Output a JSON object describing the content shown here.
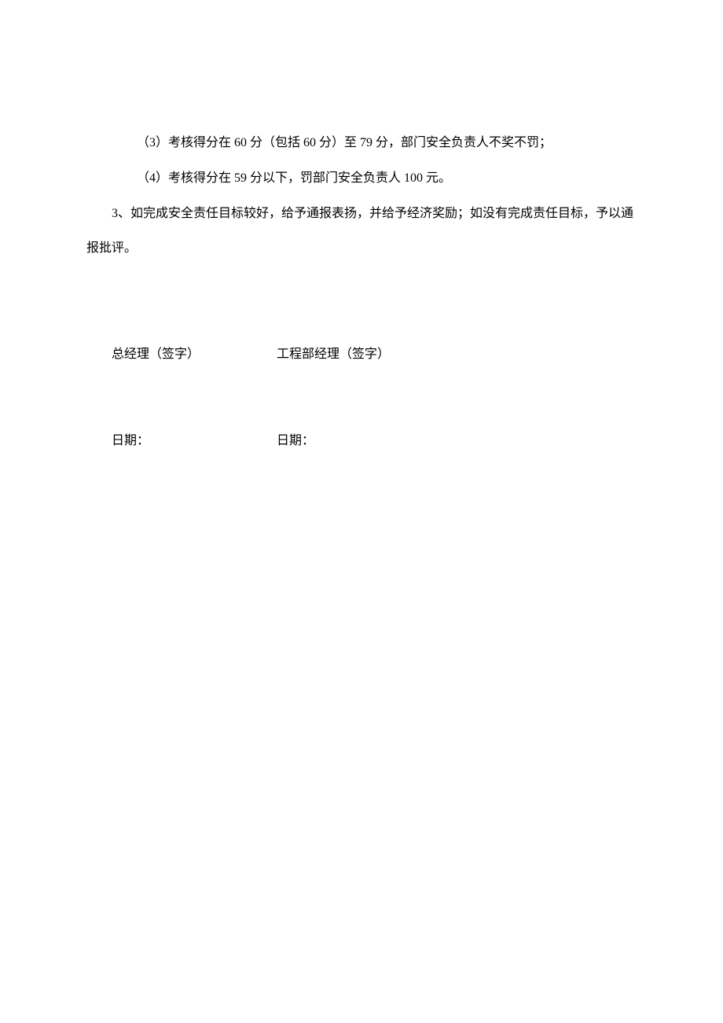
{
  "lines": {
    "item3": "（3）考核得分在 60 分（包括 60 分）至 79 分，部门安全负责人不奖不罚；",
    "item4": "（4）考核得分在 59 分以下，罚部门安全负责人 100 元。",
    "clause3": "3、如完成安全责任目标较好，给予通报表扬，并给予经济奖励；如没有完成责任目标，予以通报批评。"
  },
  "signatures": {
    "gm": "总经理（签字）",
    "eng": "工程部经理（签字）",
    "date_left": "日期：",
    "date_right": "日期："
  }
}
